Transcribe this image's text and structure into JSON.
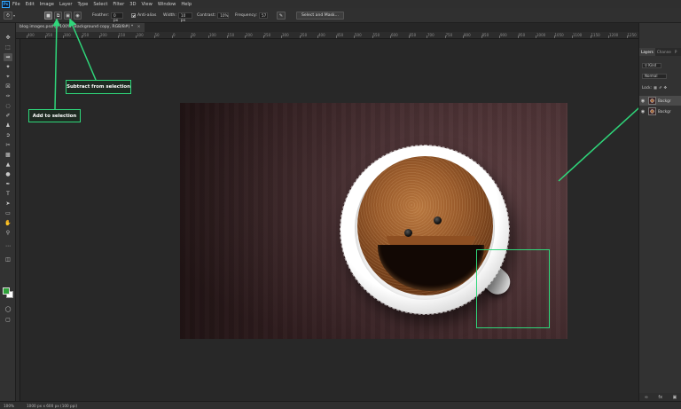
{
  "app": {
    "logo": "Ps"
  },
  "menu": [
    "File",
    "Edit",
    "Image",
    "Layer",
    "Type",
    "Select",
    "Filter",
    "3D",
    "View",
    "Window",
    "Help"
  ],
  "options_bar": {
    "feather_label": "Feather:",
    "feather_value": "0 px",
    "antialias_label": "Anti-alias",
    "width_label": "Width:",
    "width_value": "10 px",
    "contrast_label": "Contrast:",
    "contrast_value": "10%",
    "frequency_label": "Frequency:",
    "frequency_value": "57",
    "select_mask_label": "Select and Mask..."
  },
  "document_tab": {
    "title": "blog images.psd @ 100% (Background copy, RGB/8#) *"
  },
  "ruler": {
    "labels": [
      "400",
      "350",
      "300",
      "250",
      "200",
      "150",
      "100",
      "50",
      "0",
      "50",
      "100",
      "150",
      "200",
      "250",
      "300",
      "350",
      "400",
      "450",
      "500",
      "550",
      "600",
      "650",
      "700",
      "750",
      "800",
      "850",
      "900",
      "950",
      "1000",
      "1050",
      "1100",
      "1150",
      "1200",
      "1250"
    ]
  },
  "callouts": {
    "add": "Add to selection",
    "subtract": "Subtract from selection"
  },
  "layers_panel": {
    "tabs": [
      "Layers",
      "Channe",
      "P"
    ],
    "kind_label": "Kind",
    "blend_mode": "Normal",
    "lock_label": "Lock:",
    "layers": [
      {
        "name": "Backgr",
        "selected": true
      },
      {
        "name": "Backgr",
        "selected": false
      }
    ]
  },
  "status_bar": {
    "zoom": "100%",
    "doc_size": "1000 px x 600 px (100 ppi)"
  },
  "colors": {
    "accent": "#2fd67a",
    "foreground": "#2fa23a",
    "background": "#ffffff"
  }
}
